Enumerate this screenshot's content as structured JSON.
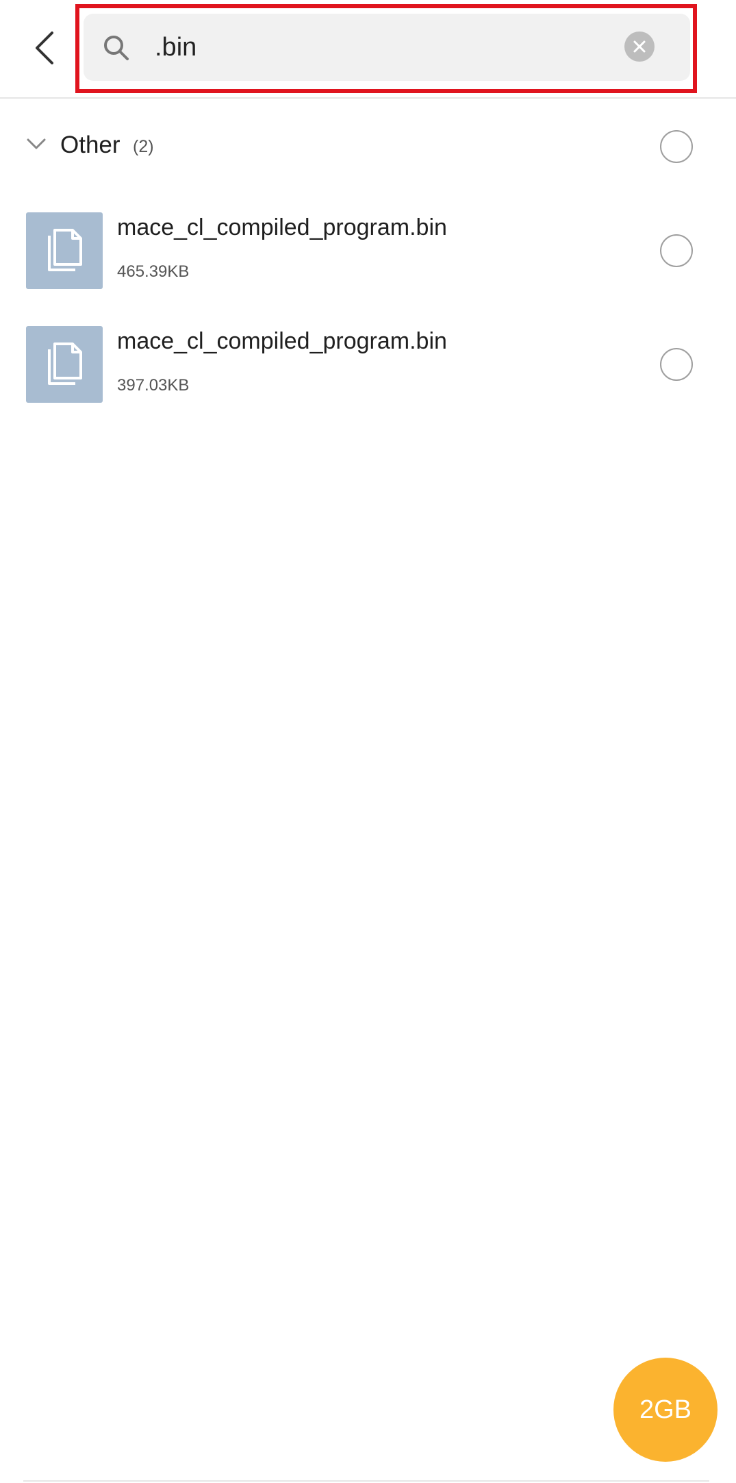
{
  "search": {
    "value": ".bin",
    "placeholder": ""
  },
  "section": {
    "title": "Other",
    "count": "(2)"
  },
  "files": [
    {
      "name": "mace_cl_compiled_program.bin",
      "size": "465.39KB"
    },
    {
      "name": "mace_cl_compiled_program.bin",
      "size": "397.03KB"
    }
  ],
  "storage_button": {
    "label": "2GB"
  },
  "colors": {
    "accent": "#fbb32f",
    "highlight_frame": "#e0141e",
    "file_thumb": "#a8bcd1"
  },
  "icons": {
    "back": "chevron-left-icon",
    "search": "search-icon",
    "clear": "clear-icon",
    "expand": "chevron-down-icon",
    "file": "document-icon"
  }
}
